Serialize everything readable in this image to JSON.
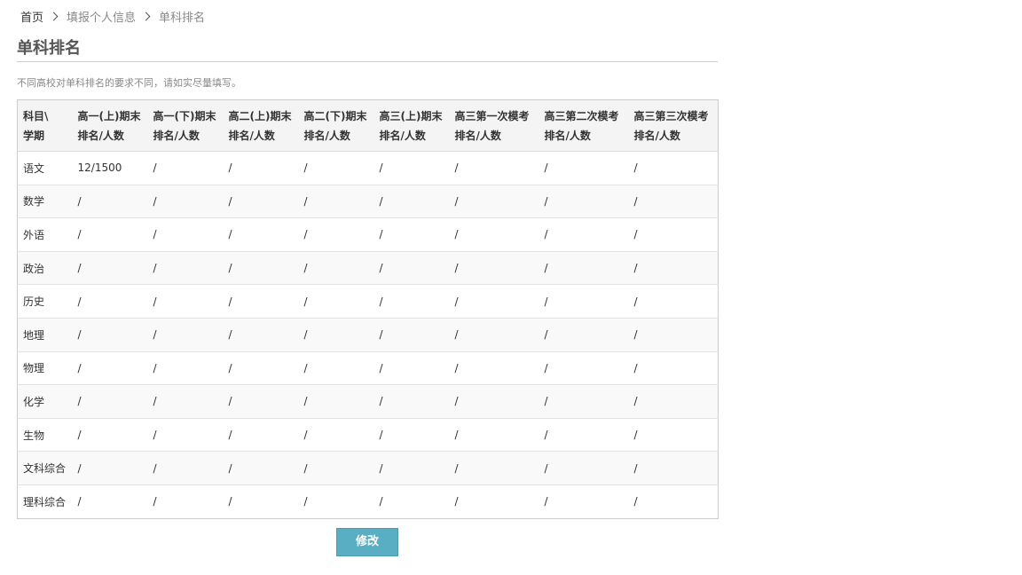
{
  "breadcrumb": {
    "home": "首页",
    "parent": "填报个人信息",
    "current": "单科排名"
  },
  "page": {
    "title": "单科排名",
    "note": "不同高校对单科排名的要求不同，请如实尽量填写。"
  },
  "table": {
    "columns": [
      [
        "科目\\",
        "学期"
      ],
      [
        "高一(上)期末",
        "排名/人数"
      ],
      [
        "高一(下)期末",
        "排名/人数"
      ],
      [
        "高二(上)期末",
        "排名/人数"
      ],
      [
        "高二(下)期末",
        "排名/人数"
      ],
      [
        "高三(上)期末",
        "排名/人数"
      ],
      [
        "高三第一次模考",
        "排名/人数"
      ],
      [
        "高三第二次模考",
        "排名/人数"
      ],
      [
        "高三第三次模考",
        "排名/人数"
      ]
    ],
    "rows": [
      [
        "语文",
        "12/1500",
        "/",
        "/",
        "/",
        "/",
        "/",
        "/",
        "/"
      ],
      [
        "数学",
        "/",
        "/",
        "/",
        "/",
        "/",
        "/",
        "/",
        "/"
      ],
      [
        "外语",
        "/",
        "/",
        "/",
        "/",
        "/",
        "/",
        "/",
        "/"
      ],
      [
        "政治",
        "/",
        "/",
        "/",
        "/",
        "/",
        "/",
        "/",
        "/"
      ],
      [
        "历史",
        "/",
        "/",
        "/",
        "/",
        "/",
        "/",
        "/",
        "/"
      ],
      [
        "地理",
        "/",
        "/",
        "/",
        "/",
        "/",
        "/",
        "/",
        "/"
      ],
      [
        "物理",
        "/",
        "/",
        "/",
        "/",
        "/",
        "/",
        "/",
        "/"
      ],
      [
        "化学",
        "/",
        "/",
        "/",
        "/",
        "/",
        "/",
        "/",
        "/"
      ],
      [
        "生物",
        "/",
        "/",
        "/",
        "/",
        "/",
        "/",
        "/",
        "/"
      ],
      [
        "文科综合",
        "/",
        "/",
        "/",
        "/",
        "/",
        "/",
        "/",
        "/"
      ],
      [
        "理科综合",
        "/",
        "/",
        "/",
        "/",
        "/",
        "/",
        "/",
        "/"
      ]
    ]
  },
  "actions": {
    "edit_label": "修改"
  },
  "colors": {
    "button": "#59aec4",
    "header_bg": "#f4f4f4",
    "stripe_bg": "#f9f9f9"
  }
}
